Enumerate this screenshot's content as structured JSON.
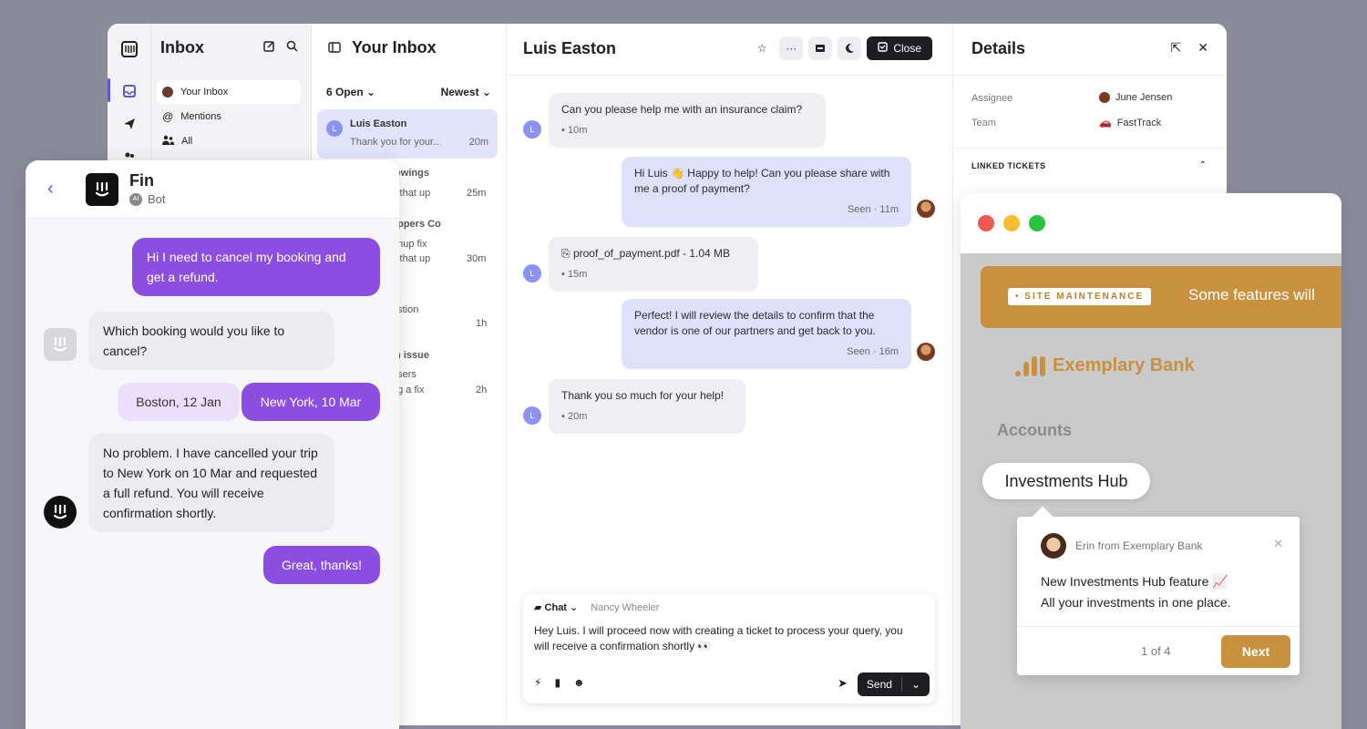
{
  "inbox_nav": {
    "title": "Inbox",
    "items": [
      {
        "label": "Your Inbox"
      },
      {
        "label": "Mentions"
      },
      {
        "label": "All"
      }
    ]
  },
  "conversation_list": {
    "title": "Your Inbox",
    "open_filter": "6 Open",
    "sort_filter": "Newest",
    "items": [
      {
        "avatar": "L",
        "name": "Luis Easton",
        "preview": "Thank you for your...",
        "time": "20m"
      },
      {
        "name_fragment": "tewings",
        "preview_fragment": "k that up",
        "time": "25m"
      },
      {
        "name_fragment": "lippers Co",
        "preview_fragment": "gnup fix",
        "preview_fragment2": "k that up",
        "time": "30m"
      },
      {
        "name_fragment": "z",
        "preview_fragment": "estion",
        "time": "1h"
      },
      {
        "name_fragment": "in issue",
        "preview_fragment": "users",
        "preview_fragment2": "ng a fix",
        "time": "2h"
      }
    ]
  },
  "chat": {
    "contact_name": "Luis Easton",
    "close_label": "Close",
    "messages": [
      {
        "text": "Can you please help me with an insurance claim?",
        "meta": "10m",
        "avatar": "L"
      },
      {
        "text": "Hi Luis 👋 Happy to help! Can you please share with me a proof of payment?",
        "meta": "Seen · 11m"
      },
      {
        "text": "proof_of_payment.pdf - 1.04 MB",
        "meta": "15m",
        "avatar": "L"
      },
      {
        "text": "Perfect! I will review the details to confirm that the vendor is one of our partners and get back to you.",
        "meta": "Seen · 16m"
      },
      {
        "text": "Thank you so much for your help!",
        "meta": "20m",
        "avatar": "L"
      }
    ],
    "composer": {
      "channel": "Chat",
      "agent": "Nancy Wheeler",
      "text": "Hey Luis. I will proceed now with creating a ticket to process your query, you will receive a confirmation shortly 👀",
      "send_label": "Send"
    }
  },
  "details": {
    "title": "Details",
    "assignee_label": "Assignee",
    "assignee_value": "June Jensen",
    "team_label": "Team",
    "team_value": "FastTrack",
    "linked_tickets_label": "LINKED TICKETS"
  },
  "fin": {
    "name": "Fin",
    "subtitle": "Bot",
    "badge": "AI",
    "messages": [
      {
        "text": "Hi I need to cancel my booking and get a refund."
      },
      {
        "text": "Which booking would you like to cancel?"
      },
      {
        "text": "No problem. I have cancelled your trip to New York on 10 Mar and requested a full refund. You will receive confirmation shortly."
      },
      {
        "text": "Great, thanks!"
      }
    ],
    "options": [
      "Boston, 12 Jan",
      "New York, 10 Mar"
    ]
  },
  "bank": {
    "banner_tag": "• SITE MAINTENANCE",
    "banner_text": "Some features will",
    "brand": "Exemplary Bank",
    "accounts_label": "Accounts",
    "hub_label": "Investments Hub",
    "tour": {
      "from": "Erin from Exemplary Bank",
      "line1": "New Investments Hub feature 📈",
      "line2": "All your investments in one place.",
      "page": "1 of 4",
      "next_label": "Next"
    },
    "colors": {
      "accent": "#c8913f"
    }
  },
  "colors": {
    "purple": "#8b4ee0",
    "agent_bubble": "#dfe1fb",
    "background": "#8b8b9b"
  }
}
